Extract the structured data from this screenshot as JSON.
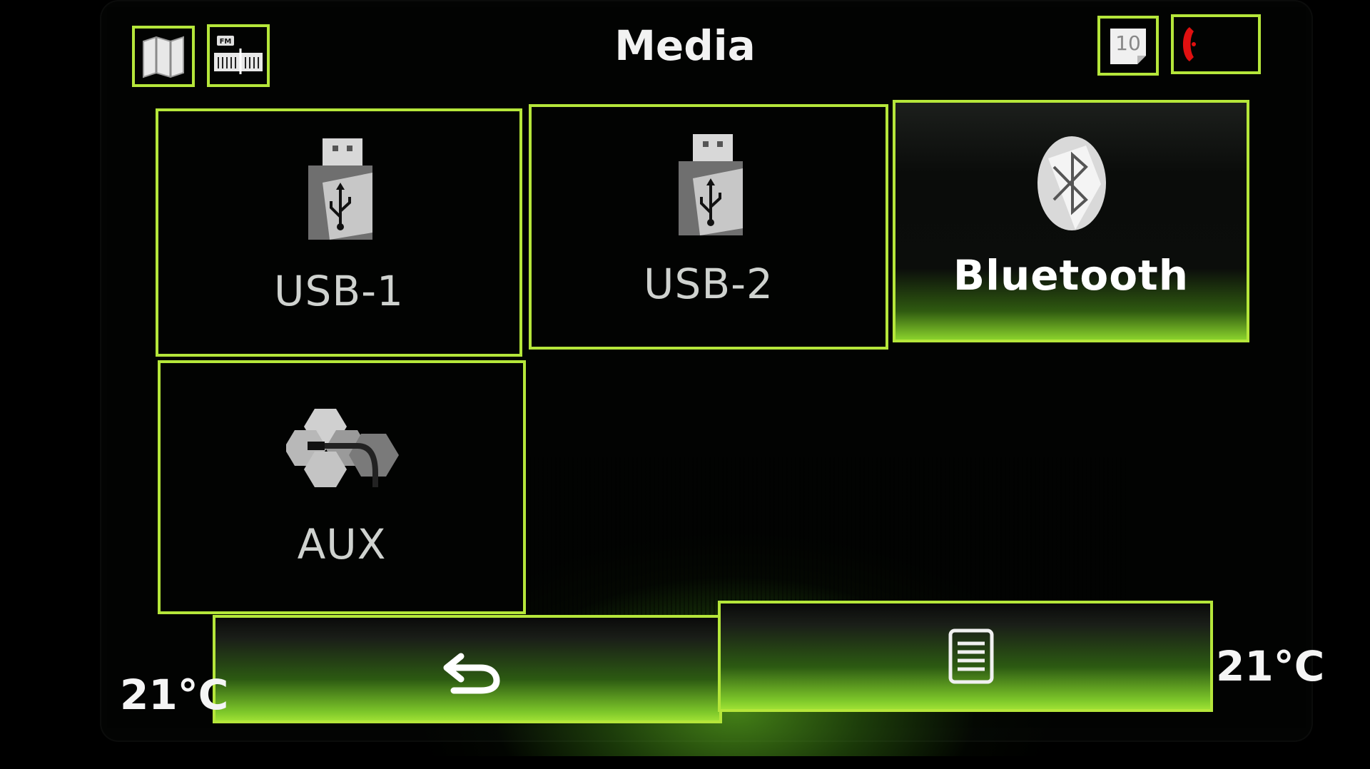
{
  "header": {
    "title": "Media",
    "left_icons": [
      "map-icon",
      "fm-radio-icon"
    ],
    "right_icons": [
      "calendar-icon",
      "phone-icon"
    ],
    "calendar_day": "10"
  },
  "tiles": [
    {
      "id": "usb-1",
      "label": "USB-1",
      "icon": "usb-drive-icon",
      "selected": false
    },
    {
      "id": "usb-2",
      "label": "USB-2",
      "icon": "usb-drive-icon",
      "selected": false
    },
    {
      "id": "bluetooth",
      "label": "Bluetooth",
      "icon": "bluetooth-icon",
      "selected": true
    },
    {
      "id": "aux",
      "label": "AUX",
      "icon": "aux-cable-icon",
      "selected": false
    }
  ],
  "footer": {
    "buttons": [
      "back-icon",
      "list-icon"
    ],
    "temp_left": "21°C",
    "temp_right": "21°C"
  },
  "colors": {
    "accent": "#b5e63a",
    "glow": "#8ad22c",
    "background": "#020302",
    "phone_icon": "#e01010"
  }
}
